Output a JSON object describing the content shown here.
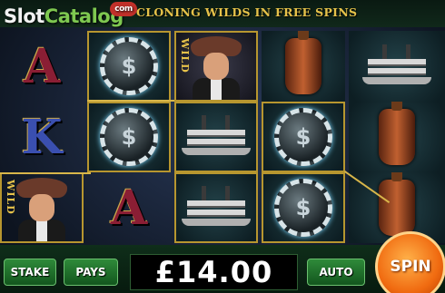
{
  "branding": {
    "logo_part1": "Slot",
    "logo_part2": "Catalog",
    "logo_badge": "com"
  },
  "banner": {
    "text": "CLONING WILDS IN FREE SPINS"
  },
  "reels": {
    "wild_label": "WILD",
    "chip_glyph": "$",
    "columns": [
      [
        "A",
        "K",
        "wild-cowboy"
      ],
      [
        "chip",
        "chip",
        "A"
      ],
      [
        "wild-cowboy",
        "riverboat",
        "riverboat"
      ],
      [
        "whiskey-bottle",
        "chip",
        "chip"
      ],
      [
        "riverboat",
        "whiskey-bottle",
        "whiskey-bottle"
      ]
    ]
  },
  "controls": {
    "stake_label": "STAKE",
    "pays_label": "PAYS",
    "amount": "£14.00",
    "auto_label": "AUTO",
    "spin_label": "SPIN"
  },
  "colors": {
    "gold": "#d8b64a",
    "spin_orange": "#f06a10",
    "button_green": "#2f8a3a"
  }
}
